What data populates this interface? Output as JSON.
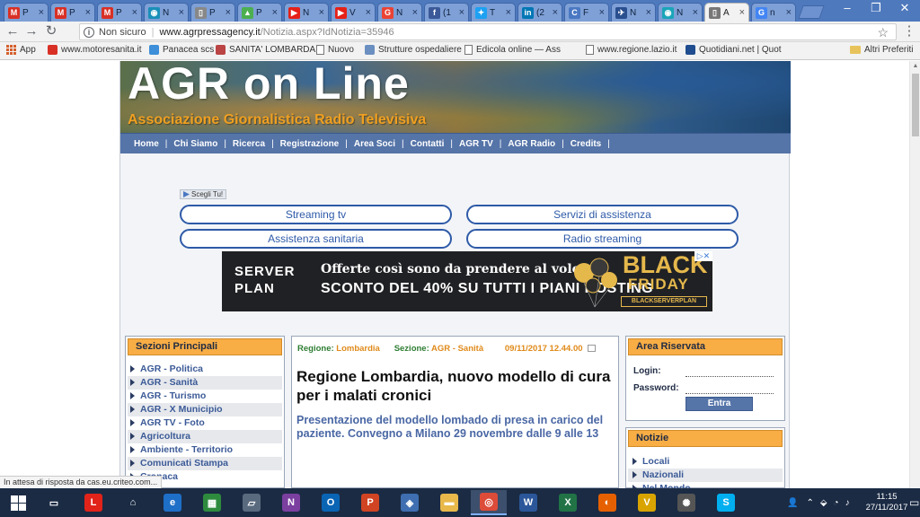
{
  "browser": {
    "tabs": [
      {
        "title": "P",
        "icon": "gmail-icon",
        "color": "#d93025",
        "glyph": "M"
      },
      {
        "title": "P",
        "icon": "gmail-icon",
        "color": "#d93025",
        "glyph": "M"
      },
      {
        "title": "P",
        "icon": "gmail-icon",
        "color": "#d93025",
        "glyph": "M"
      },
      {
        "title": "N",
        "icon": "globe-icon",
        "color": "#1a8fb8",
        "glyph": "◉"
      },
      {
        "title": "P",
        "icon": "doc-icon",
        "color": "#888888",
        "glyph": "▯"
      },
      {
        "title": "P",
        "icon": "drive-icon",
        "color": "#4caf50",
        "glyph": "▲"
      },
      {
        "title": "N",
        "icon": "youtube-icon",
        "color": "#e62117",
        "glyph": "▶"
      },
      {
        "title": "V",
        "icon": "youtube-icon",
        "color": "#e62117",
        "glyph": "▶"
      },
      {
        "title": "N",
        "icon": "google-icon",
        "color": "#ea4335",
        "glyph": "G"
      },
      {
        "title": "(1",
        "icon": "facebook-icon",
        "color": "#3b5998",
        "glyph": "f"
      },
      {
        "title": "T",
        "icon": "twitter-icon",
        "color": "#1da1f2",
        "glyph": "✦"
      },
      {
        "title": "(2",
        "icon": "linkedin-icon",
        "color": "#0077b5",
        "glyph": "in"
      },
      {
        "title": "F",
        "icon": "refresh-site-icon",
        "color": "#4a78c2",
        "glyph": "C"
      },
      {
        "title": "N",
        "icon": "map-icon",
        "color": "#2a4f8f",
        "glyph": "✈"
      },
      {
        "title": "N",
        "icon": "globe-icon",
        "color": "#1aa5b8",
        "glyph": "◉"
      },
      {
        "title": "A",
        "icon": "doc-icon",
        "color": "#777777",
        "glyph": "▯"
      },
      {
        "title": "n",
        "icon": "google-icon",
        "color": "#4285f4",
        "glyph": "G"
      }
    ],
    "active_tab_index": 15,
    "address": {
      "security_label": "Non sicuro",
      "host": "www.agrpressagency.it",
      "path": "/Notizia.aspx?IdNotizia=35946"
    },
    "bookmarks": [
      {
        "label": "App",
        "icon": "apps-icon"
      },
      {
        "label": "www.motoresanita.it",
        "icon": "gmail-icon"
      },
      {
        "label": "Panacea scs",
        "icon": "site-icon"
      },
      {
        "label": "SANITA' LOMBARDA",
        "icon": "site-icon"
      },
      {
        "label": "Nuovo",
        "icon": "doc-icon"
      },
      {
        "label": "Strutture ospedaliere",
        "icon": "site-icon"
      },
      {
        "label": "Edicola online — Ass",
        "icon": "doc-icon"
      },
      {
        "label": "www.regione.lazio.it",
        "icon": "doc-icon"
      },
      {
        "label": "Quotidiani.net | Quot",
        "icon": "quotidiani-icon"
      },
      {
        "label": "Altri Preferiti",
        "icon": "folder-icon"
      }
    ],
    "status_text": "In attesa di risposta da cas.eu.criteo.com..."
  },
  "site": {
    "banner_title": "AGR on Line",
    "banner_subtitle": "Associazione Giornalistica Radio Televisiva",
    "nav": [
      "Home",
      "Chi Siamo",
      "Ricerca",
      "Registrazione",
      "Area Soci",
      "Contatti",
      "AGR TV",
      "AGR Radio",
      "Credits"
    ],
    "scegli_label": "Scegli Tu!",
    "pills": [
      "Streaming tv",
      "Servizi di assistenza",
      "Assistenza sanitaria",
      "Radio streaming"
    ],
    "ad": {
      "logo_top": "SERVER",
      "logo_bottom": "PLAN",
      "line1": "Offerte così sono da prendere al volo!",
      "line2": "SCONTO DEL 40% SU TUTTI I PIANI HOSTING",
      "black": "BLACK",
      "friday": "FRIDAY",
      "code": "BLACKSERVERPLAN"
    },
    "sections": {
      "title": "Sezioni Principali",
      "items": [
        "AGR - Politica",
        "AGR - Sanità",
        "AGR - Turismo",
        "AGR - X Municipio",
        "AGR TV - Foto",
        "Agricoltura",
        "Ambiente - Territorio",
        "Comunicati Stampa",
        "Cronaca"
      ]
    },
    "article": {
      "region_label": "Regione:",
      "region_value": "Lombardia",
      "section_label": "Sezione:",
      "section_value": "AGR - Sanità",
      "date": "09/11/2017 12.44.00",
      "title": "Regione Lombardia, nuovo modello di cura per i malati cronici",
      "subtitle": "Presentazione del modello lombado di presa in carico del paziente. Convegno a Milano 29 novembre dalle 9 alle 13"
    },
    "area_riservata": {
      "title": "Area Riservata",
      "login_label": "Login:",
      "password_label": "Password:",
      "button": "Entra"
    },
    "notizie": {
      "title": "Notizie",
      "items": [
        "Locali",
        "Nazionali",
        "Nel Mondo"
      ]
    }
  },
  "taskbar": {
    "apps": [
      {
        "name": "task-view-icon",
        "color": "#1b2b44",
        "glyph": "▭"
      },
      {
        "name": "lenovo-icon",
        "color": "#e2231a",
        "glyph": "L"
      },
      {
        "name": "home-icon",
        "color": "#1b2b44",
        "glyph": "⌂"
      },
      {
        "name": "edge-icon",
        "color": "#1e6fc8",
        "glyph": "e"
      },
      {
        "name": "calculator-icon",
        "color": "#2e8b3e",
        "glyph": "▦"
      },
      {
        "name": "scanner-icon",
        "color": "#5a6a7e",
        "glyph": "▱"
      },
      {
        "name": "onenote-icon",
        "color": "#7b3fa0",
        "glyph": "N"
      },
      {
        "name": "outlook-icon",
        "color": "#0a64b4",
        "glyph": "O"
      },
      {
        "name": "powerpoint-icon",
        "color": "#d04423",
        "glyph": "P"
      },
      {
        "name": "security-icon",
        "color": "#3f6fb0",
        "glyph": "◈"
      },
      {
        "name": "file-explorer-icon",
        "color": "#e8b84a",
        "glyph": "▬"
      },
      {
        "name": "chrome-icon",
        "color": "#dd4b39",
        "glyph": "◎"
      },
      {
        "name": "word-icon",
        "color": "#2b579a",
        "glyph": "W"
      },
      {
        "name": "excel-icon",
        "color": "#217346",
        "glyph": "X"
      },
      {
        "name": "firefox-icon",
        "color": "#e66000",
        "glyph": "◐"
      },
      {
        "name": "vectorworks-icon",
        "color": "#d9a400",
        "glyph": "V"
      },
      {
        "name": "film-reel-icon",
        "color": "#555555",
        "glyph": "✺"
      },
      {
        "name": "skype-icon",
        "color": "#00aff0",
        "glyph": "S"
      }
    ],
    "active_index": 11,
    "time": "11:15",
    "date": "27/11/2017"
  }
}
